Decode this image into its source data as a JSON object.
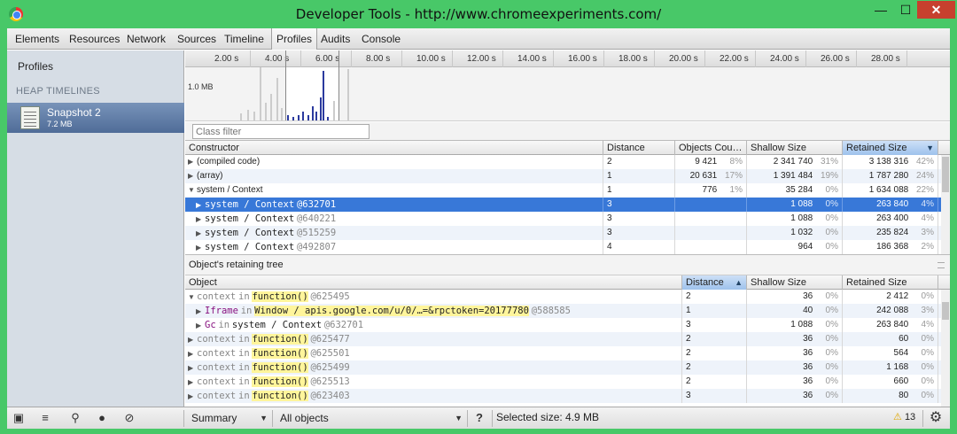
{
  "window": {
    "title": "Developer Tools - http://www.chromeexperiments.com/"
  },
  "tabs": [
    "Elements",
    "Resources",
    "Network",
    "Sources",
    "Timeline",
    "Profiles",
    "Audits",
    "Console"
  ],
  "active_tab": "Profiles",
  "sidebar": {
    "profiles_label": "Profiles",
    "heap_header": "HEAP TIMELINES",
    "snapshot_name": "Snapshot 2",
    "snapshot_size": "7.2 MB"
  },
  "overview": {
    "ticks": [
      "2.00 s",
      "4.00 s",
      "6.00 s",
      "8.00 s",
      "10.00 s",
      "12.00 s",
      "14.00 s",
      "16.00 s",
      "18.00 s",
      "20.00 s",
      "22.00 s",
      "24.00 s",
      "26.00 s",
      "28.00 s"
    ],
    "scale_label": "1.0 MB"
  },
  "filter": {
    "placeholder": "Class filter"
  },
  "constructor_grid": {
    "headers": [
      "Constructor",
      "Distance",
      "Objects Cou…",
      "Shallow Size",
      "Retained Size"
    ],
    "rows": [
      {
        "name": "(compiled code)",
        "distance": "2",
        "objects": "9 421",
        "objects_pct": "8%",
        "shallow": "2 341 740",
        "shallow_pct": "31%",
        "retained": "3 138 316",
        "retained_pct": "42%"
      },
      {
        "name": "(array)",
        "distance": "1",
        "objects": "20 631",
        "objects_pct": "17%",
        "shallow": "1 391 484",
        "shallow_pct": "19%",
        "retained": "1 787 280",
        "retained_pct": "24%"
      },
      {
        "name": "system / Context",
        "distance": "1",
        "objects": "776",
        "objects_pct": "1%",
        "shallow": "35 284",
        "shallow_pct": "0%",
        "retained": "1 634 088",
        "retained_pct": "22%"
      },
      {
        "name": "system / Context",
        "id": "@632701",
        "distance": "3",
        "objects": "",
        "objects_pct": "",
        "shallow": "1 088",
        "shallow_pct": "0%",
        "retained": "263 840",
        "retained_pct": "4%"
      },
      {
        "name": "system / Context",
        "id": "@640221",
        "distance": "3",
        "objects": "",
        "objects_pct": "",
        "shallow": "1 088",
        "shallow_pct": "0%",
        "retained": "263 400",
        "retained_pct": "4%"
      },
      {
        "name": "system / Context",
        "id": "@515259",
        "distance": "3",
        "objects": "",
        "objects_pct": "",
        "shallow": "1 032",
        "shallow_pct": "0%",
        "retained": "235 824",
        "retained_pct": "3%"
      },
      {
        "name": "system / Context",
        "id": "@492807",
        "distance": "4",
        "objects": "",
        "objects_pct": "",
        "shallow": "964",
        "shallow_pct": "0%",
        "retained": "186 368",
        "retained_pct": "2%"
      }
    ]
  },
  "retaining_tree": {
    "title": "Object's retaining tree",
    "headers": [
      "Object",
      "Distance",
      "Shallow Size",
      "Retained Size"
    ],
    "rows": [
      {
        "kw1": "context",
        "in": "in",
        "fn": "function()",
        "id": "@625495",
        "distance": "2",
        "shallow": "36",
        "shallow_pct": "0%",
        "retained": "2 412",
        "retained_pct": "0%"
      },
      {
        "prop": "Iframe",
        "in": "in",
        "fn": "Window / apis.google.com/u/0/…=&rpctoken=20177780",
        "id": "@588585",
        "distance": "1",
        "shallow": "40",
        "shallow_pct": "0%",
        "retained": "242 088",
        "retained_pct": "3%"
      },
      {
        "prop": "Gc",
        "in": "in",
        "fn": "system / Context",
        "id": "@632701",
        "distance": "3",
        "shallow": "1 088",
        "shallow_pct": "0%",
        "retained": "263 840",
        "retained_pct": "4%"
      },
      {
        "kw1": "context",
        "in": "in",
        "fn": "function()",
        "id": "@625477",
        "distance": "2",
        "shallow": "36",
        "shallow_pct": "0%",
        "retained": "60",
        "retained_pct": "0%"
      },
      {
        "kw1": "context",
        "in": "in",
        "fn": "function()",
        "id": "@625501",
        "distance": "2",
        "shallow": "36",
        "shallow_pct": "0%",
        "retained": "564",
        "retained_pct": "0%"
      },
      {
        "kw1": "context",
        "in": "in",
        "fn": "function()",
        "id": "@625499",
        "distance": "2",
        "shallow": "36",
        "shallow_pct": "0%",
        "retained": "1 168",
        "retained_pct": "0%"
      },
      {
        "kw1": "context",
        "in": "in",
        "fn": "function()",
        "id": "@625513",
        "distance": "2",
        "shallow": "36",
        "shallow_pct": "0%",
        "retained": "660",
        "retained_pct": "0%"
      },
      {
        "kw1": "context",
        "in": "in",
        "fn": "function()",
        "id": "@623403",
        "distance": "3",
        "shallow": "36",
        "shallow_pct": "0%",
        "retained": "80",
        "retained_pct": "0%"
      }
    ]
  },
  "statusbar": {
    "view": "Summary",
    "filter": "All objects",
    "help": "?",
    "selected_size": "Selected size: 4.9 MB",
    "warnings": "13"
  },
  "colors": {
    "accent": "#3878d8",
    "frame": "#48c868",
    "highlight": "#fff59b"
  }
}
